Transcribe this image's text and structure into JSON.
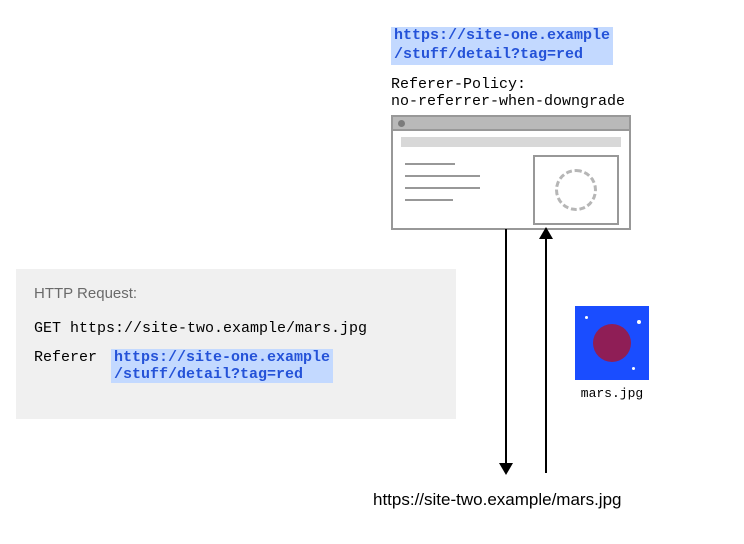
{
  "top_url": {
    "line1": "https://site-one.example",
    "line2": "/stuff/detail?tag=red"
  },
  "policy": {
    "line1": "Referer-Policy:",
    "line2": "no-referrer-when-downgrade"
  },
  "request": {
    "title": "HTTP Request:",
    "get_line": "GET https://site-two.example/mars.jpg",
    "referer_label": "Referer",
    "referer_value": {
      "line1": "https://site-one.example",
      "line2": "/stuff/detail?tag=red"
    }
  },
  "mars_label": "mars.jpg",
  "bottom_url": "https://site-two.example/mars.jpg"
}
